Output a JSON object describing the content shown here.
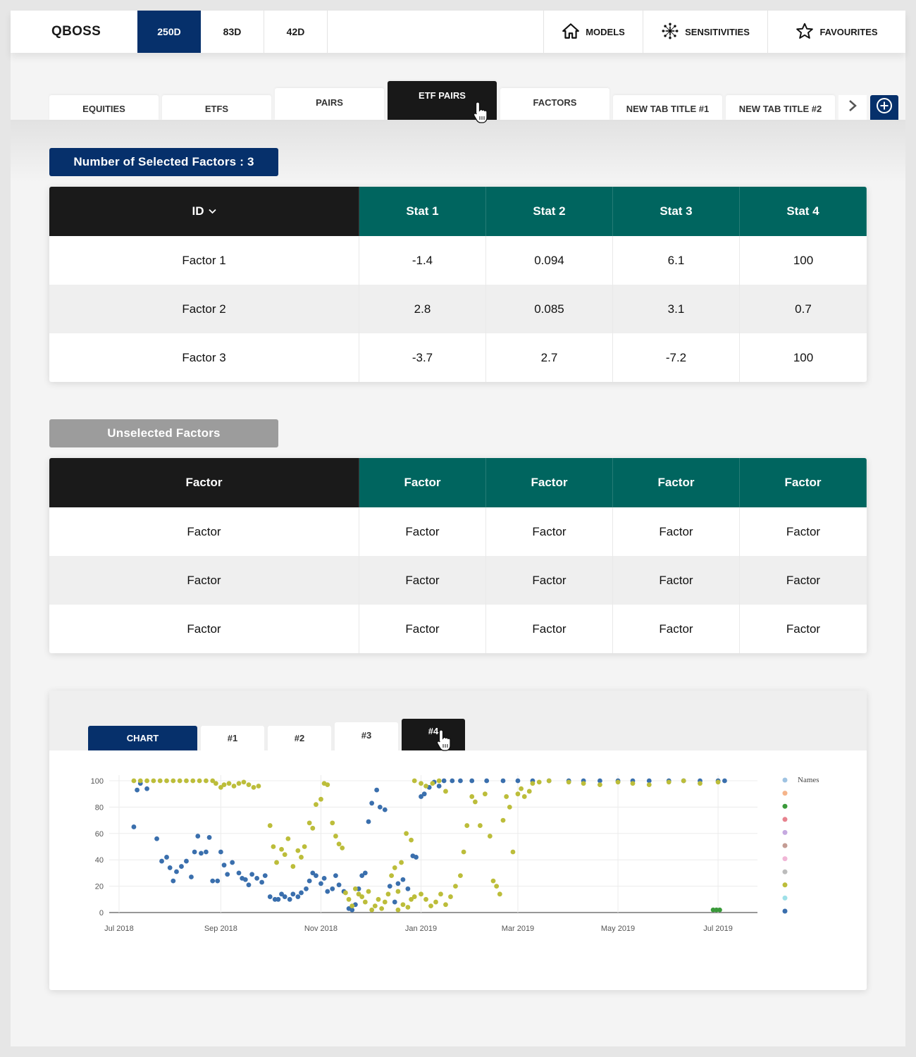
{
  "app": {
    "brand": "QBOSS"
  },
  "periods": [
    "250D",
    "83D",
    "42D"
  ],
  "active_period": 0,
  "nav": {
    "models": "MODELS",
    "sensitivities": "SENSITIVITIES",
    "favourites": "FAVOURITES"
  },
  "tabs": [
    "EQUITIES",
    "ETFS",
    "PAIRS",
    "ETF PAIRS",
    "FACTORS",
    "NEW TAB TITLE #1",
    "NEW TAB TITLE #2"
  ],
  "active_tab": 3,
  "selected": {
    "label": "Number of Selected Factors : 3",
    "headers": [
      "ID",
      "Stat 1",
      "Stat 2",
      "Stat 3",
      "Stat 4"
    ],
    "rows": [
      [
        "Factor 1",
        "-1.4",
        "0.094",
        "6.1",
        "100"
      ],
      [
        "Factor 2",
        "2.8",
        "0.085",
        "3.1",
        "0.7"
      ],
      [
        "Factor 3",
        "-3.7",
        "2.7",
        "-7.2",
        "100"
      ]
    ]
  },
  "unselected": {
    "label": "Unselected Factors",
    "headers": [
      "Factor",
      "Factor",
      "Factor",
      "Factor",
      "Factor"
    ],
    "rows": [
      [
        "Factor",
        "Factor",
        "Factor",
        "Factor",
        "Factor"
      ],
      [
        "Factor",
        "Factor",
        "Factor",
        "Factor",
        "Factor"
      ],
      [
        "Factor",
        "Factor",
        "Factor",
        "Factor",
        "Factor"
      ]
    ]
  },
  "chart_tabs": [
    "CHART",
    "#1",
    "#2",
    "#3",
    "#4"
  ],
  "active_chart_tab": 4,
  "colors": {
    "brand_blue": "#06306b",
    "teal": "#00655f",
    "dark": "#181818",
    "series_blue": "#3a6fad",
    "series_olive": "#bcbd3a",
    "series_green": "#3a9a3a"
  },
  "chart_data": {
    "type": "scatter",
    "title": "",
    "xlabel": "",
    "ylabel": "",
    "x_range": [
      "2018-06-25",
      "2019-07-25"
    ],
    "ylim": [
      0,
      100
    ],
    "y_ticks": [
      0,
      20,
      40,
      60,
      80,
      100
    ],
    "x_ticks": [
      {
        "label": "Jul 2018",
        "date": "2018-07-01"
      },
      {
        "label": "Sep 2018",
        "date": "2018-09-01"
      },
      {
        "label": "Nov 2018",
        "date": "2018-11-01"
      },
      {
        "label": "Jan 2019",
        "date": "2019-01-01"
      },
      {
        "label": "Mar 2019",
        "date": "2019-03-01"
      },
      {
        "label": "May 2019",
        "date": "2019-05-01"
      },
      {
        "label": "Jul 2019",
        "date": "2019-07-01"
      }
    ],
    "legend": {
      "title": "Names",
      "placement": "right",
      "swatches": [
        "#9fc3e2",
        "#f5b48a",
        "#3a9a3a",
        "#e7828e",
        "#c5a9e0",
        "#c49c94",
        "#f0b6d6",
        "#bcbcbc",
        "#bcbd3a",
        "#9ee0e8",
        "#3a6fad"
      ]
    },
    "series": [
      {
        "color": "#3a6fad",
        "points": [
          [
            "2018-07-10",
            65
          ],
          [
            "2018-07-12",
            93
          ],
          [
            "2018-07-14",
            98
          ],
          [
            "2018-07-18",
            94
          ],
          [
            "2018-07-24",
            56
          ],
          [
            "2018-07-27",
            39
          ],
          [
            "2018-07-30",
            42
          ],
          [
            "2018-08-01",
            34
          ],
          [
            "2018-08-03",
            24
          ],
          [
            "2018-08-05",
            31
          ],
          [
            "2018-08-08",
            35
          ],
          [
            "2018-08-11",
            39
          ],
          [
            "2018-08-14",
            27
          ],
          [
            "2018-08-16",
            46
          ],
          [
            "2018-08-18",
            58
          ],
          [
            "2018-08-20",
            45
          ],
          [
            "2018-08-23",
            46
          ],
          [
            "2018-08-25",
            57
          ],
          [
            "2018-08-27",
            24
          ],
          [
            "2018-08-30",
            24
          ],
          [
            "2018-09-01",
            46
          ],
          [
            "2018-09-03",
            36
          ],
          [
            "2018-09-05",
            29
          ],
          [
            "2018-09-08",
            38
          ],
          [
            "2018-09-12",
            30
          ],
          [
            "2018-09-14",
            26
          ],
          [
            "2018-09-16",
            25
          ],
          [
            "2018-09-18",
            21
          ],
          [
            "2018-09-20",
            29
          ],
          [
            "2018-09-23",
            26
          ],
          [
            "2018-09-26",
            23
          ],
          [
            "2018-09-28",
            28
          ],
          [
            "2018-10-01",
            12
          ],
          [
            "2018-10-04",
            10
          ],
          [
            "2018-10-06",
            10
          ],
          [
            "2018-10-08",
            14
          ],
          [
            "2018-10-10",
            12
          ],
          [
            "2018-10-13",
            10
          ],
          [
            "2018-10-15",
            14
          ],
          [
            "2018-10-18",
            12
          ],
          [
            "2018-10-20",
            15
          ],
          [
            "2018-10-23",
            18
          ],
          [
            "2018-10-25",
            24
          ],
          [
            "2018-10-27",
            30
          ],
          [
            "2018-10-29",
            28
          ],
          [
            "2018-11-01",
            22
          ],
          [
            "2018-11-03",
            26
          ],
          [
            "2018-11-05",
            16
          ],
          [
            "2018-11-08",
            18
          ],
          [
            "2018-11-10",
            28
          ],
          [
            "2018-11-12",
            21
          ],
          [
            "2018-11-15",
            16
          ],
          [
            "2018-11-18",
            3
          ],
          [
            "2018-11-20",
            2
          ],
          [
            "2018-11-22",
            6
          ],
          [
            "2018-11-24",
            18
          ],
          [
            "2018-11-26",
            28
          ],
          [
            "2018-11-28",
            30
          ],
          [
            "2018-11-30",
            69
          ],
          [
            "2018-12-02",
            83
          ],
          [
            "2018-12-05",
            93
          ],
          [
            "2018-12-07",
            80
          ],
          [
            "2018-12-10",
            78
          ],
          [
            "2018-12-13",
            20
          ],
          [
            "2018-12-16",
            8
          ],
          [
            "2018-12-18",
            22
          ],
          [
            "2018-12-21",
            25
          ],
          [
            "2018-12-24",
            18
          ],
          [
            "2018-12-27",
            43
          ],
          [
            "2018-12-29",
            42
          ],
          [
            "2019-01-01",
            88
          ],
          [
            "2019-01-03",
            90
          ],
          [
            "2019-01-06",
            95
          ],
          [
            "2019-01-09",
            99
          ],
          [
            "2019-01-12",
            96
          ],
          [
            "2019-01-15",
            100
          ],
          [
            "2019-01-20",
            100
          ],
          [
            "2019-01-25",
            100
          ],
          [
            "2019-02-01",
            100
          ],
          [
            "2019-02-10",
            100
          ],
          [
            "2019-02-20",
            100
          ],
          [
            "2019-03-01",
            100
          ],
          [
            "2019-03-10",
            100
          ],
          [
            "2019-03-20",
            100
          ],
          [
            "2019-04-01",
            100
          ],
          [
            "2019-04-10",
            100
          ],
          [
            "2019-04-20",
            100
          ],
          [
            "2019-05-01",
            100
          ],
          [
            "2019-05-10",
            100
          ],
          [
            "2019-05-20",
            100
          ],
          [
            "2019-06-01",
            100
          ],
          [
            "2019-06-10",
            100
          ],
          [
            "2019-06-20",
            100
          ],
          [
            "2019-07-01",
            100
          ],
          [
            "2019-07-05",
            100
          ]
        ]
      },
      {
        "color": "#bcbd3a",
        "points": [
          [
            "2018-07-10",
            100
          ],
          [
            "2018-07-14",
            100
          ],
          [
            "2018-07-18",
            100
          ],
          [
            "2018-07-22",
            100
          ],
          [
            "2018-07-26",
            100
          ],
          [
            "2018-07-30",
            100
          ],
          [
            "2018-08-03",
            100
          ],
          [
            "2018-08-07",
            100
          ],
          [
            "2018-08-11",
            100
          ],
          [
            "2018-08-15",
            100
          ],
          [
            "2018-08-19",
            100
          ],
          [
            "2018-08-23",
            100
          ],
          [
            "2018-08-27",
            100
          ],
          [
            "2018-08-29",
            98
          ],
          [
            "2018-09-01",
            95
          ],
          [
            "2018-09-03",
            97
          ],
          [
            "2018-09-06",
            98
          ],
          [
            "2018-09-09",
            96
          ],
          [
            "2018-09-12",
            98
          ],
          [
            "2018-09-15",
            99
          ],
          [
            "2018-09-18",
            97
          ],
          [
            "2018-09-21",
            95
          ],
          [
            "2018-09-24",
            96
          ],
          [
            "2018-10-01",
            66
          ],
          [
            "2018-10-03",
            50
          ],
          [
            "2018-10-05",
            38
          ],
          [
            "2018-10-08",
            48
          ],
          [
            "2018-10-10",
            44
          ],
          [
            "2018-10-12",
            56
          ],
          [
            "2018-10-15",
            35
          ],
          [
            "2018-10-18",
            47
          ],
          [
            "2018-10-20",
            42
          ],
          [
            "2018-10-22",
            50
          ],
          [
            "2018-10-25",
            68
          ],
          [
            "2018-10-27",
            64
          ],
          [
            "2018-10-29",
            82
          ],
          [
            "2018-11-01",
            86
          ],
          [
            "2018-11-03",
            98
          ],
          [
            "2018-11-05",
            97
          ],
          [
            "2018-11-08",
            68
          ],
          [
            "2018-11-10",
            58
          ],
          [
            "2018-11-12",
            52
          ],
          [
            "2018-11-14",
            49
          ],
          [
            "2018-11-16",
            15
          ],
          [
            "2018-11-18",
            10
          ],
          [
            "2018-11-20",
            5
          ],
          [
            "2018-11-22",
            18
          ],
          [
            "2018-11-24",
            14
          ],
          [
            "2018-11-26",
            12
          ],
          [
            "2018-11-28",
            8
          ],
          [
            "2018-11-30",
            16
          ],
          [
            "2018-12-02",
            2
          ],
          [
            "2018-12-04",
            5
          ],
          [
            "2018-12-06",
            10
          ],
          [
            "2018-12-08",
            3
          ],
          [
            "2018-12-10",
            8
          ],
          [
            "2018-12-12",
            14
          ],
          [
            "2018-12-14",
            28
          ],
          [
            "2018-12-16",
            34
          ],
          [
            "2018-12-18",
            16
          ],
          [
            "2018-12-20",
            38
          ],
          [
            "2018-12-23",
            60
          ],
          [
            "2018-12-26",
            55
          ],
          [
            "2018-12-28",
            100
          ],
          [
            "2019-01-01",
            98
          ],
          [
            "2019-01-04",
            96
          ],
          [
            "2019-01-08",
            98
          ],
          [
            "2019-01-12",
            100
          ],
          [
            "2019-01-16",
            92
          ],
          [
            "2018-12-18",
            2
          ],
          [
            "2018-12-21",
            6
          ],
          [
            "2018-12-24",
            4
          ],
          [
            "2018-12-26",
            10
          ],
          [
            "2018-12-28",
            12
          ],
          [
            "2019-01-01",
            14
          ],
          [
            "2019-01-04",
            10
          ],
          [
            "2019-01-07",
            5
          ],
          [
            "2019-01-10",
            8
          ],
          [
            "2019-01-13",
            14
          ],
          [
            "2019-01-16",
            6
          ],
          [
            "2019-01-19",
            12
          ],
          [
            "2019-01-22",
            20
          ],
          [
            "2019-01-25",
            28
          ],
          [
            "2019-01-27",
            46
          ],
          [
            "2019-01-29",
            66
          ],
          [
            "2019-02-01",
            88
          ],
          [
            "2019-02-03",
            84
          ],
          [
            "2019-02-06",
            66
          ],
          [
            "2019-02-09",
            90
          ],
          [
            "2019-02-12",
            58
          ],
          [
            "2019-02-14",
            24
          ],
          [
            "2019-02-16",
            20
          ],
          [
            "2019-02-18",
            14
          ],
          [
            "2019-02-20",
            70
          ],
          [
            "2019-02-22",
            88
          ],
          [
            "2019-02-24",
            80
          ],
          [
            "2019-02-26",
            46
          ],
          [
            "2019-03-01",
            90
          ],
          [
            "2019-03-03",
            94
          ],
          [
            "2019-03-05",
            88
          ],
          [
            "2019-03-08",
            92
          ],
          [
            "2019-03-10",
            98
          ],
          [
            "2019-03-14",
            99
          ],
          [
            "2019-03-20",
            100
          ],
          [
            "2019-04-01",
            99
          ],
          [
            "2019-04-10",
            98
          ],
          [
            "2019-04-20",
            97
          ],
          [
            "2019-05-01",
            99
          ],
          [
            "2019-05-10",
            98
          ],
          [
            "2019-05-20",
            97
          ],
          [
            "2019-06-01",
            99
          ],
          [
            "2019-06-10",
            100
          ],
          [
            "2019-06-20",
            98
          ],
          [
            "2019-07-01",
            99
          ]
        ]
      },
      {
        "color": "#3a9a3a",
        "points": [
          [
            "2019-06-28",
            2
          ],
          [
            "2019-06-30",
            2
          ],
          [
            "2019-07-02",
            2
          ]
        ]
      }
    ]
  }
}
